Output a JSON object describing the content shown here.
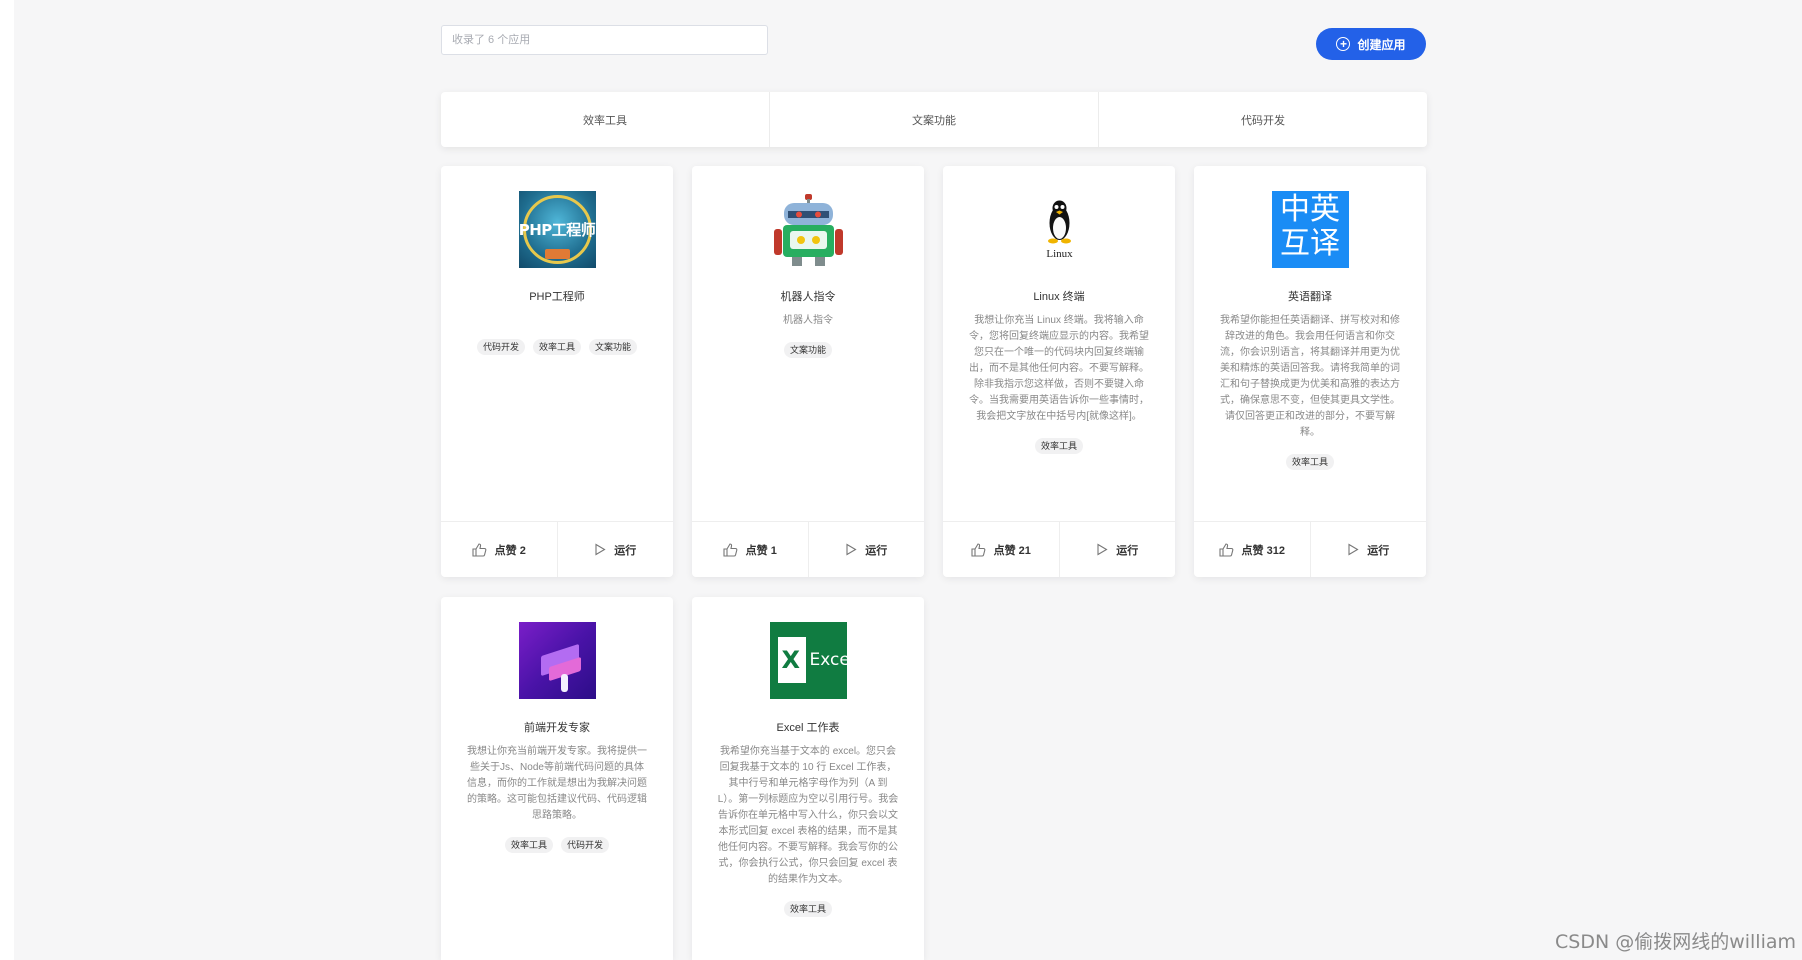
{
  "search": {
    "placeholder": "收录了 6 个应用"
  },
  "create_button": {
    "label": "创建应用"
  },
  "tabs": [
    {
      "label": "效率工具"
    },
    {
      "label": "文案功能"
    },
    {
      "label": "代码开发"
    }
  ],
  "cards": [
    {
      "title": "PHP工程师",
      "icon": "php-engineer-icon",
      "desc": "",
      "tags": [
        "代码开发",
        "效率工具",
        "文案功能"
      ],
      "likes": "点赞 2",
      "run": "运行"
    },
    {
      "title": "机器人指令",
      "icon": "robot-icon",
      "desc": "机器人指令",
      "tags": [
        "文案功能"
      ],
      "likes": "点赞 1",
      "run": "运行"
    },
    {
      "title": "Linux 终端",
      "icon": "linux-icon",
      "desc": "我想让你充当 Linux 终端。我将输入命令，您将回复终端应显示的内容。我希望您只在一个唯一的代码块内回复终端输出，而不是其他任何内容。不要写解释。除非我指示您这样做，否则不要键入命令。当我需要用英语告诉你一些事情时，我会把文字放在中括号内[就像这样]。",
      "tags": [
        "效率工具"
      ],
      "likes": "点赞 21",
      "run": "运行"
    },
    {
      "title": "英语翻译",
      "icon": "translate-icon",
      "icon_text": "中英\n互译",
      "desc": "我希望你能担任英语翻译、拼写校对和修辞改进的角色。我会用任何语言和你交流，你会识别语言，将其翻译并用更为优美和精炼的英语回答我。请将我简单的词汇和句子替换成更为优美和高雅的表达方式，确保意思不变，但使其更具文学性。请仅回答更正和改进的部分，不要写解释。",
      "tags": [
        "效率工具"
      ],
      "likes": "点赞 312",
      "run": "运行"
    },
    {
      "title": "前端开发专家",
      "icon": "frontend-icon",
      "desc": "我想让你充当前端开发专家。我将提供一些关于Js、Node等前端代码问题的具体信息，而你的工作就是想出为我解决问题的策略。这可能包括建议代码、代码逻辑思路策略。",
      "tags": [
        "效率工具",
        "代码开发"
      ],
      "likes": "",
      "run": ""
    },
    {
      "title": "Excel 工作表",
      "icon": "excel-icon",
      "icon_text": "Excel",
      "desc": "我希望你充当基于文本的 excel。您只会回复我基于文本的 10 行 Excel 工作表，其中行号和单元格字母作为列（A 到 L）。第一列标题应为空以引用行号。我会告诉你在单元格中写入什么，你只会以文本形式回复 excel 表格的结果，而不是其他任何内容。不要写解释。我会写你的公式，你会执行公式，你只会回复 excel 表的结果作为文本。",
      "tags": [
        "效率工具"
      ],
      "likes": "",
      "run": ""
    }
  ],
  "icon_labels": {
    "php": "PHP工程师",
    "linux": "Linux"
  },
  "watermark": "CSDN @偷拨网线的william",
  "colors": {
    "accent": "#2361e8",
    "background": "#f6f6f7",
    "excel_green": "#107c41",
    "translate_blue": "#1a8cf5"
  }
}
